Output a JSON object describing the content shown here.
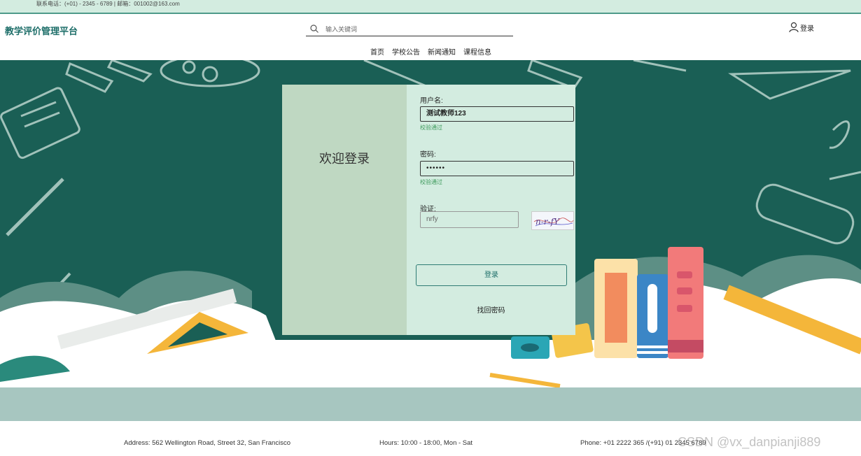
{
  "topbar": {
    "contact": "联系电话：(+01) - 2345 - 6789 | 邮箱：001002@163.com"
  },
  "header": {
    "logo": "教学评价管理平台",
    "search_placeholder": "输入关键词",
    "login_label": "登录",
    "nav": [
      "首页",
      "学校公告",
      "新闻通知",
      "课程信息"
    ]
  },
  "login_card": {
    "welcome": "欢迎登录",
    "username_label": "用户名:",
    "username_value": "测试教师123",
    "username_hint": "校验通过",
    "password_label": "密码:",
    "password_value": "••••••",
    "password_hint": "校验通过",
    "captcha_label": "验证:",
    "captcha_value": "nrfy",
    "captcha_image_text": "n-r-fY",
    "login_button": "登录",
    "forgot_link": "找回密码"
  },
  "footer": {
    "address": "Address: 562 Wellington Road, Street 32, San Francisco",
    "hours": "Hours: 10:00 - 18:00, Mon - Sat",
    "phone": "Phone: +01 2222 365 /(+91) 01 2345 6789"
  },
  "watermark": "CSDN @vx_danpianji889",
  "colors": {
    "accent": "#1f6f6a",
    "panel": "#d3ece0",
    "board": "#1a5f55",
    "hint": "#3e9a5c"
  }
}
